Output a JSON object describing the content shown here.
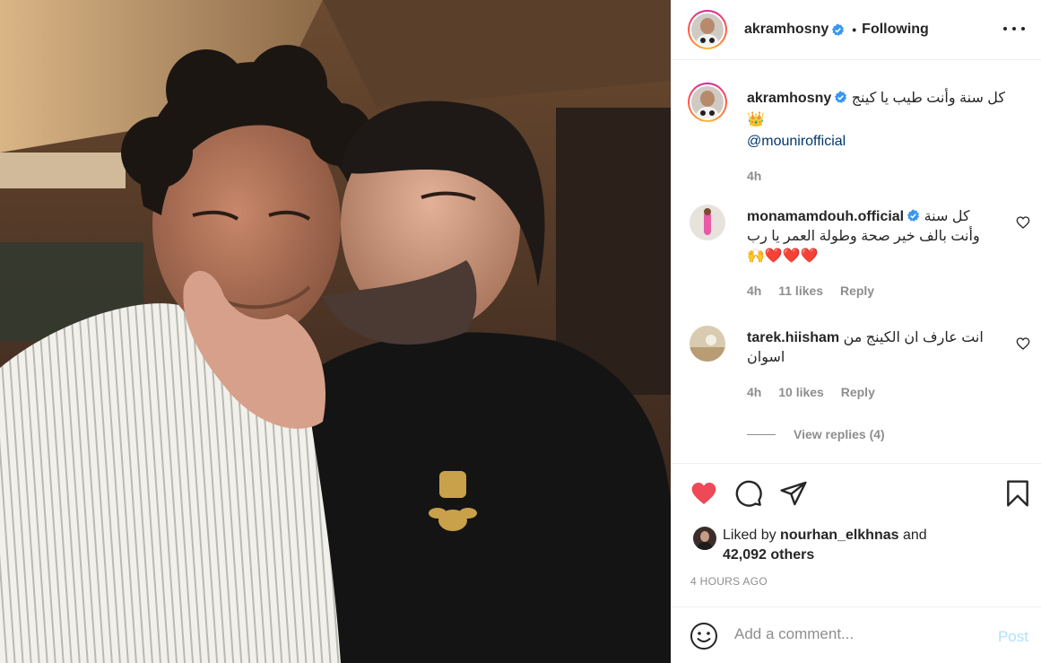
{
  "post": {
    "author": "akramhosny",
    "follow_state": "Following",
    "dot": "•",
    "caption_text": "كل سنة وأنت طيب يا كينج",
    "caption_emoji": "👑",
    "caption_mention": "@mounirofficial",
    "caption_time": "4h"
  },
  "comments": [
    {
      "user": "monamamdouh.official",
      "text_line1": "كل سنة",
      "text_line2": "وأنت بالف خير صحة وطولة العمر يا رب",
      "emojis": "🙌❤️❤️❤️",
      "time": "4h",
      "likes": "11 likes",
      "reply": "Reply"
    },
    {
      "user": "tarek.hiisham",
      "text_line1": "انت عارف ان الكينج من",
      "text_line2": "اسوان",
      "time": "4h",
      "likes": "10 likes",
      "reply": "Reply"
    }
  ],
  "view_replies": "View replies (4)",
  "likes": {
    "prefix": "Liked by",
    "user": "nourhan_elkhnas",
    "and": "and",
    "others": "42,092 others"
  },
  "timestamp": "4 HOURS AGO",
  "add_comment": {
    "placeholder": "Add a comment...",
    "post_label": "Post"
  },
  "colors": {
    "heart_red": "#ed4956",
    "link_blue": "#00376b",
    "post_disabled": "#b2dffc",
    "verified_blue": "#3897f0"
  },
  "icons": [
    "verified-badge-icon",
    "more-options-icon",
    "heart-outline-icon",
    "heart-filled-icon",
    "comment-icon",
    "share-icon",
    "bookmark-icon",
    "emoji-icon"
  ]
}
